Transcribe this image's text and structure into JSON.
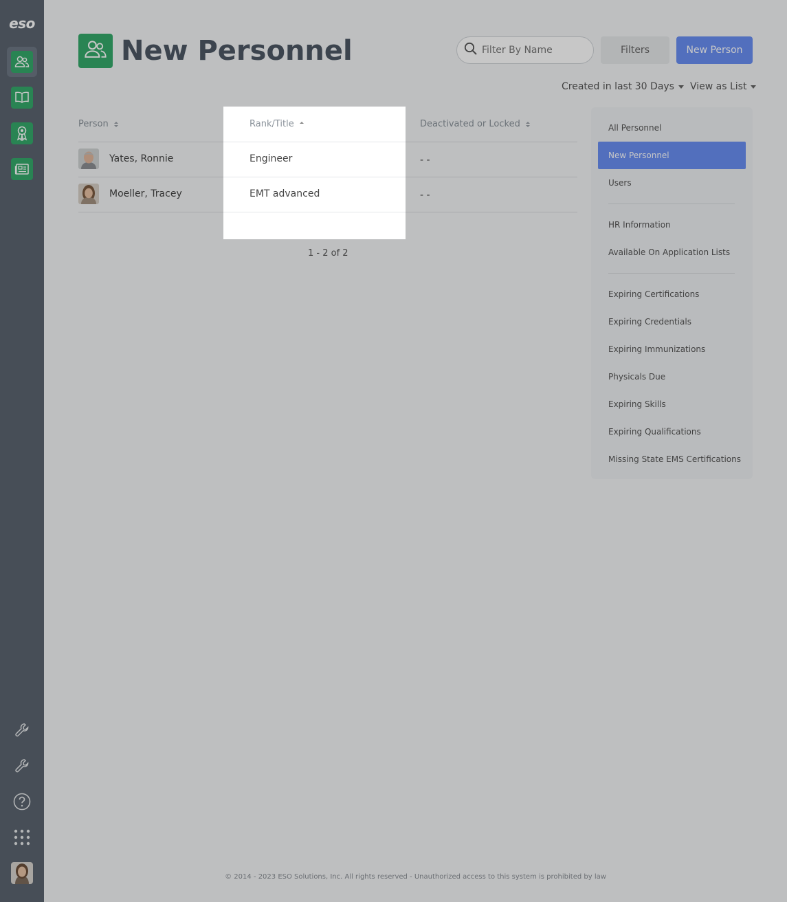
{
  "brand": {
    "logo_text": "eso",
    "accent": "#35a96b",
    "primary": "#6a8ff3"
  },
  "rail": {
    "items": [
      {
        "name": "personnel-icon",
        "active": true
      },
      {
        "name": "book-icon"
      },
      {
        "name": "award-icon"
      },
      {
        "name": "news-icon"
      }
    ],
    "bottom": [
      {
        "name": "wrench-icon"
      },
      {
        "name": "wrench-icon"
      },
      {
        "name": "help-icon"
      },
      {
        "name": "apps-grid-icon"
      }
    ]
  },
  "header": {
    "title": "New Personnel",
    "search_placeholder": "Filter By Name",
    "filters_label": "Filters",
    "new_person_label": "New Person",
    "created_filter": "Created in last 30 Days",
    "view_mode": "View as List"
  },
  "table": {
    "columns": [
      "Person",
      "Rank/Title",
      "Deactivated or Locked"
    ],
    "sorted_column": "Rank/Title",
    "rows": [
      {
        "person": "Yates, Ronnie",
        "rank": "Engineer",
        "status": "- -"
      },
      {
        "person": "Moeller, Tracey",
        "rank": "EMT advanced",
        "status": "- -"
      }
    ],
    "pager": "1 - 2 of 2"
  },
  "sidepanel": {
    "groups": [
      [
        "All Personnel",
        "New Personnel",
        "Users"
      ],
      [
        "HR Information",
        "Available On Application Lists"
      ],
      [
        "Expiring Certifications",
        "Expiring Credentials",
        "Expiring Immunizations",
        "Physicals Due",
        "Expiring Skills",
        "Expiring Qualifications",
        "Missing State EMS Certifications"
      ]
    ],
    "active": "New Personnel"
  },
  "footer": "© 2014 - 2023 ESO Solutions, Inc. All rights reserved - Unauthorized access to this system is prohibited by law"
}
